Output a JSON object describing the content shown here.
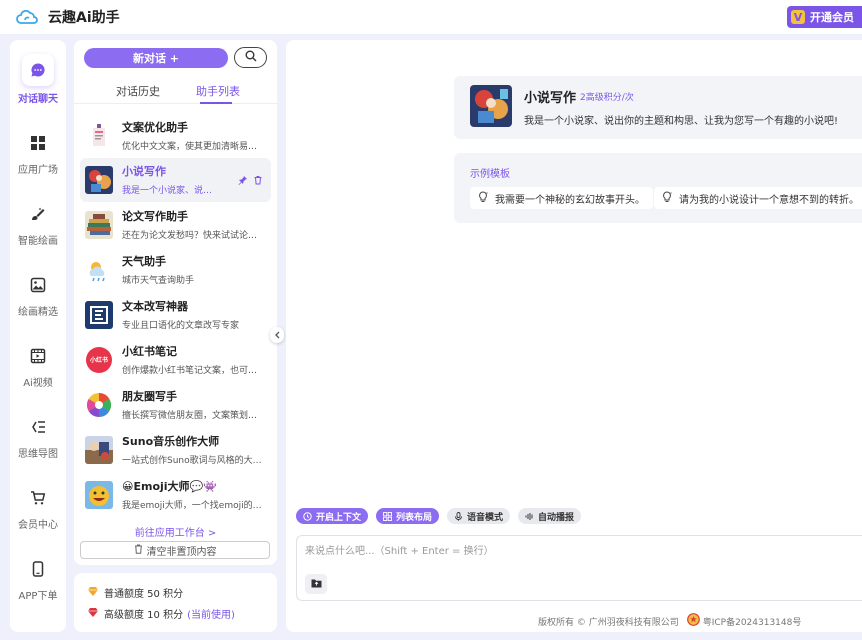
{
  "app": {
    "title": "云趣Ai助手",
    "vip_label": "开通会员",
    "vip_badge": "V"
  },
  "nav": [
    {
      "label": "对话聊天",
      "icon": "chat-icon",
      "active": true
    },
    {
      "label": "应用广场",
      "icon": "grid-icon"
    },
    {
      "label": "智能绘画",
      "icon": "paint-icon"
    },
    {
      "label": "绘画精选",
      "icon": "image-icon"
    },
    {
      "label": "Ai视频",
      "icon": "video-icon"
    },
    {
      "label": "思维导图",
      "icon": "mindmap-icon"
    },
    {
      "label": "会员中心",
      "icon": "cart-icon"
    },
    {
      "label": "APP下单",
      "icon": "phone-icon"
    }
  ],
  "panel": {
    "new_chat": "新对话 +",
    "tabs": [
      "对话历史",
      "助手列表"
    ],
    "active_tab": 1,
    "items": [
      {
        "title": "文案优化助手",
        "desc": "优化中文文案，使其更加清晰易懂有...",
        "icon": "doc-helper-icon"
      },
      {
        "title": "小说写作",
        "desc": "我是一个小说家、说出...",
        "icon": "novel-thumb-icon",
        "active": true
      },
      {
        "title": "论文写作助手",
        "desc": "还在为论文发愁吗？快来试试论文代...",
        "icon": "books-icon"
      },
      {
        "title": "天气助手",
        "desc": "城市天气查询助手",
        "icon": "weather-icon"
      },
      {
        "title": "文本改写神器",
        "desc": "专业且口语化的文章改写专家",
        "icon": "rewrite-icon"
      },
      {
        "title": "小红书笔记",
        "desc": "创作爆款小红书笔记文案，也可以用...",
        "icon": "xiaohongshu-icon",
        "badge": "小红书"
      },
      {
        "title": "朋友圈写手",
        "desc": "擅长撰写微信朋友圈，文案策划，推...",
        "icon": "moments-icon"
      },
      {
        "title": "Suno音乐创作大师",
        "desc": "一站式创作Suno歌词与风格的大师。...",
        "icon": "music-icon"
      },
      {
        "title": "😀Emoji大师💬👾",
        "desc": "我是emoji大师，一个找emoji的神器...",
        "icon": "emoji-icon"
      }
    ],
    "goto_link": "前往应用工作台 >",
    "clear_btn": "清空非置顶内容"
  },
  "quota": {
    "normal": "普通额度 50 积分",
    "advanced": "高级额度 10 积分",
    "current": "(当前使用)"
  },
  "assistant": {
    "title": "小说写作",
    "cost": "2高级积分/次",
    "desc": "我是一个小说家、说出你的主题和构思、让我为您写一个有趣的小说吧!"
  },
  "examples": {
    "title": "示例模板",
    "items": [
      "我需要一个神秘的玄幻故事开头。",
      "请为我的小说设计一个意想不到的转折。"
    ]
  },
  "toolbar": [
    "开启上下文",
    "列表布局",
    "语音模式",
    "自动播报"
  ],
  "input": {
    "placeholder": "来说点什么吧...（Shift + Enter = 换行）"
  },
  "footer": {
    "copyright": "版权所有 © 广州羽夜科技有限公司",
    "icp": "粤ICP备2024313148号"
  },
  "colors": {
    "accent": "#7b55e8",
    "accent_light": "#8c6cf0",
    "bg": "#eef1fb",
    "vip_badge": "#f5c13b"
  }
}
